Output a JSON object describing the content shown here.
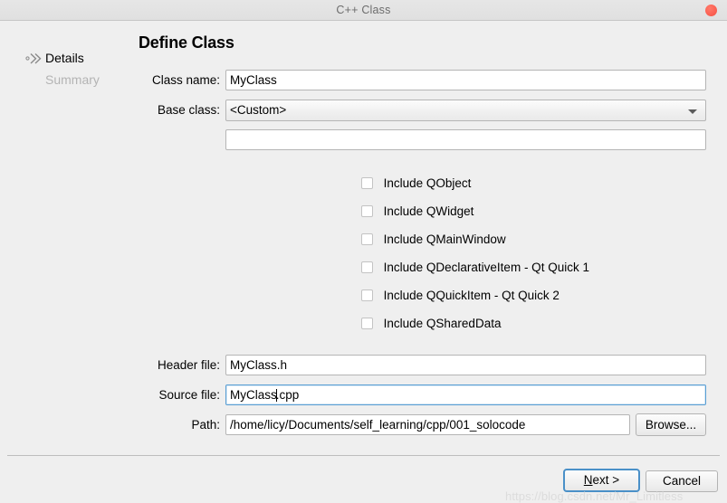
{
  "window": {
    "title": "C++ Class",
    "close_icon": "close-circle-icon",
    "close_color": "#fc6254"
  },
  "sidebar": {
    "items": [
      {
        "label": "Details",
        "state": "active",
        "icon": "chevron-double-right-icon"
      },
      {
        "label": "Summary",
        "state": "inactive"
      }
    ]
  },
  "main": {
    "page_title": "Define Class",
    "fields": {
      "class_name": {
        "label": "Class name:",
        "value": "MyClass",
        "placeholder": ""
      },
      "base_class": {
        "label": "Base class:",
        "value": "<Custom>",
        "options": [
          "<Custom>"
        ],
        "arrow_icon": "chevron-down-icon"
      },
      "custom_base_class": {
        "value": "",
        "placeholder": ""
      },
      "header_file": {
        "label": "Header file:",
        "value": "MyClass.h",
        "placeholder": ""
      },
      "source_file": {
        "label": "Source file:",
        "value_before_caret": "MyClass",
        "value_after_caret": ".cpp",
        "focused": true,
        "placeholder": ""
      },
      "path": {
        "label": "Path:",
        "value": "/home/licy/Documents/self_learning/cpp/001_solocode",
        "placeholder": "",
        "browse_label": "Browse..."
      }
    },
    "checkboxes": [
      {
        "label": "Include QObject",
        "checked": false
      },
      {
        "label": "Include QWidget",
        "checked": false
      },
      {
        "label": "Include QMainWindow",
        "checked": false
      },
      {
        "label": "Include QDeclarativeItem - Qt Quick 1",
        "checked": false
      },
      {
        "label": "Include QQuickItem - Qt Quick 2",
        "checked": false
      },
      {
        "label": "Include QSharedData",
        "checked": false
      }
    ]
  },
  "footer": {
    "next_label_prefix": "",
    "next_mnemonic": "N",
    "next_label_suffix": "ext >",
    "cancel_label": "Cancel",
    "watermark": "https://blog.csdn.net/Mr_Limitless"
  },
  "colors": {
    "background": "#efefef",
    "titlebar": "#e3e3e3",
    "focus_blue": "#4a90c8",
    "inactive_text": "#b4b4b4"
  }
}
